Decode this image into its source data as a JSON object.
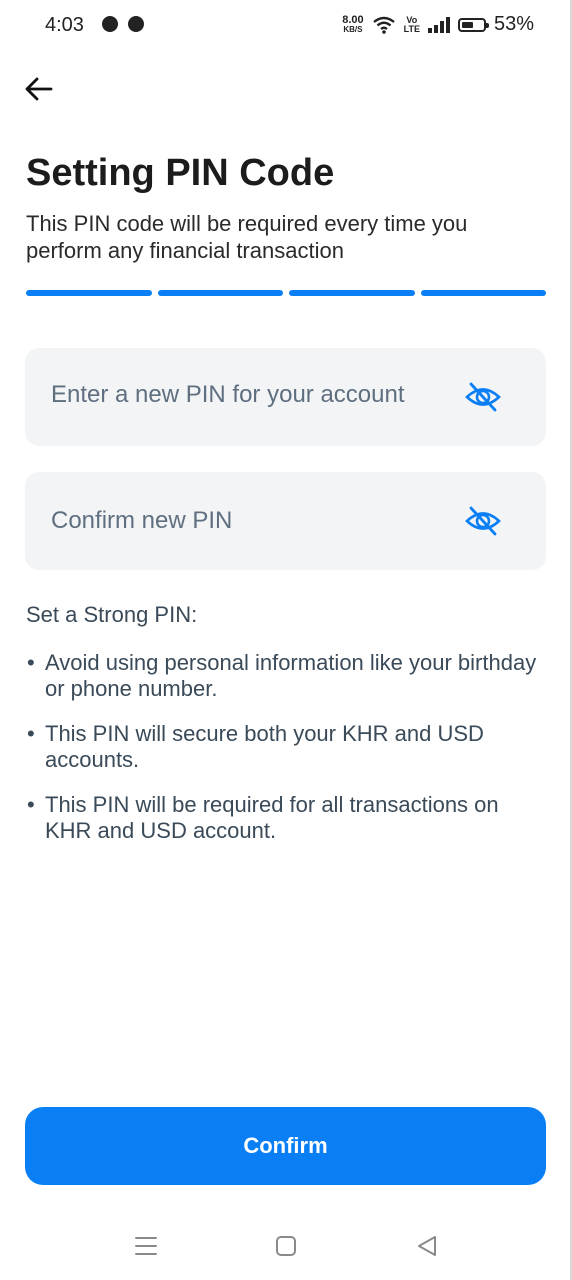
{
  "status_bar": {
    "time": "4:03",
    "net_speed_value": "8.00",
    "net_speed_unit": "KB/S",
    "volte_top": "Vo",
    "volte_bottom": "LTE",
    "battery_percent": "53%",
    "battery_level": 0.53,
    "icons": [
      "chat-bubble-icon",
      "messenger-icon",
      "wifi-icon",
      "signal-icon",
      "battery-icon"
    ]
  },
  "header": {
    "back_icon": "arrow-left-icon",
    "title": "Setting PIN Code",
    "subtitle": "This PIN code will be required every time you perform any financial transaction"
  },
  "progress": {
    "steps_total": 4,
    "steps_complete": 4,
    "color": "#0a7ff5"
  },
  "form": {
    "new_pin": {
      "placeholder": "Enter a new PIN for your account",
      "value": "",
      "toggle_icon": "eye-off-icon"
    },
    "confirm_pin": {
      "placeholder": "Confirm new PIN",
      "value": "",
      "toggle_icon": "eye-off-icon"
    }
  },
  "tips": {
    "title": "Set a Strong PIN:",
    "items": [
      "Avoid using personal information like your birthday or phone number.",
      "This PIN will secure both your KHR and USD accounts.",
      "This PIN will be required for all transactions on KHR and USD account."
    ]
  },
  "actions": {
    "confirm_label": "Confirm",
    "accent": "#0a7ff5"
  },
  "system_nav": {
    "icons": [
      "menu-icon",
      "home-icon",
      "back-triangle-icon"
    ]
  }
}
